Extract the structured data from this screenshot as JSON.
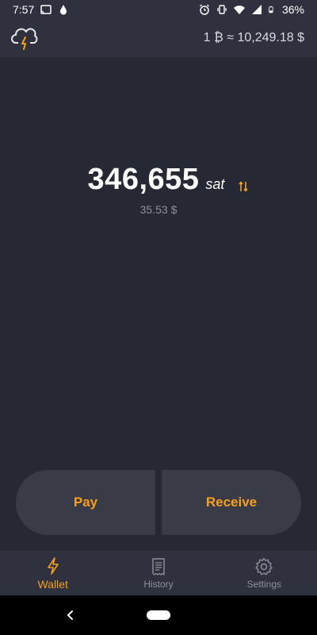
{
  "status_bar": {
    "time": "7:57",
    "battery": "36%",
    "icons_left": [
      "cast-icon",
      "drop-icon"
    ],
    "icons_right": [
      "alarm-icon",
      "vibrate-icon",
      "wifi-icon",
      "signal-icon",
      "battery-icon"
    ]
  },
  "header": {
    "logo_icon": "lightning-cloud-icon",
    "rate": "1 ₿ ≈ 10,249.18 $"
  },
  "balance": {
    "amount": "346,655",
    "unit": "sat",
    "fiat": "35.53 $",
    "toggle_icon": "swap-arrows-icon"
  },
  "actions": {
    "pay_label": "Pay",
    "receive_label": "Receive"
  },
  "nav": {
    "items": [
      {
        "label": "Wallet",
        "icon": "lightning-icon",
        "active": true
      },
      {
        "label": "History",
        "icon": "receipt-icon",
        "active": false
      },
      {
        "label": "Settings",
        "icon": "gear-icon",
        "active": false
      }
    ]
  },
  "colors": {
    "background": "#262834",
    "bar": "#2f323e",
    "button": "#393b47",
    "accent": "#f5a01c",
    "muted": "#8e909a"
  }
}
